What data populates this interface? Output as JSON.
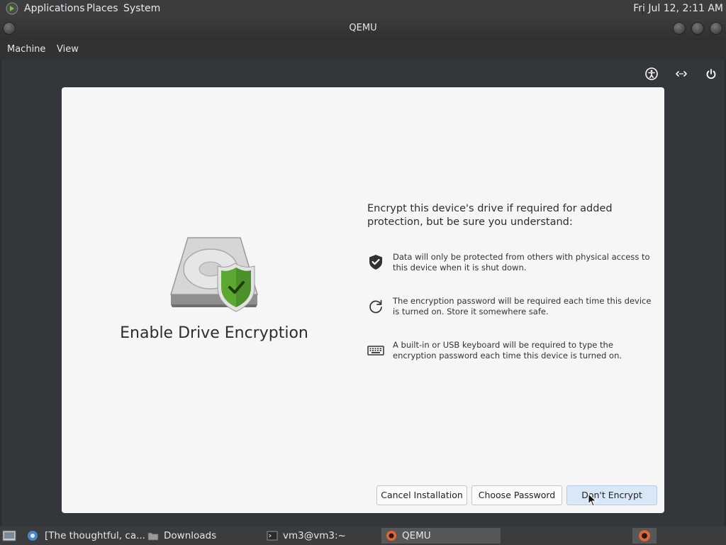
{
  "topbar": {
    "menus": [
      "Applications",
      "Places",
      "System"
    ],
    "clock": "Fri Jul 12,  2:11 AM"
  },
  "window": {
    "title": "QEMU"
  },
  "menubar": {
    "items": [
      "Machine",
      "View"
    ]
  },
  "vm_toolbar": {
    "icons": [
      "accessibility-icon",
      "network-icon",
      "power-icon"
    ]
  },
  "dialog": {
    "heading": "Enable Drive Encryption",
    "intro": "Encrypt this device's drive if required for added protection, but be sure you understand:",
    "items": [
      {
        "icon": "shield-check-icon",
        "text": "Data will only be protected from others with physical access to this device when it is shut down."
      },
      {
        "icon": "restart-icon",
        "text": "The encryption password will be required each time this device is turned on. Store it somewhere safe."
      },
      {
        "icon": "keyboard-icon",
        "text": "A built-in or USB keyboard will be required to type the encryption password each time this device is turned on."
      }
    ],
    "buttons": {
      "cancel": "Cancel Installation",
      "choose_password": "Choose Password",
      "dont_encrypt": "Don't Encrypt"
    }
  },
  "taskbar": {
    "tasks": [
      {
        "label": "[The thoughtful, ca..."
      },
      {
        "label": "Downloads"
      },
      {
        "label": "vm3@vm3:~"
      },
      {
        "label": "QEMU",
        "active": true
      }
    ]
  },
  "colors": {
    "shield_green": "#5aa832",
    "primary_button": "#d8e8f6"
  }
}
